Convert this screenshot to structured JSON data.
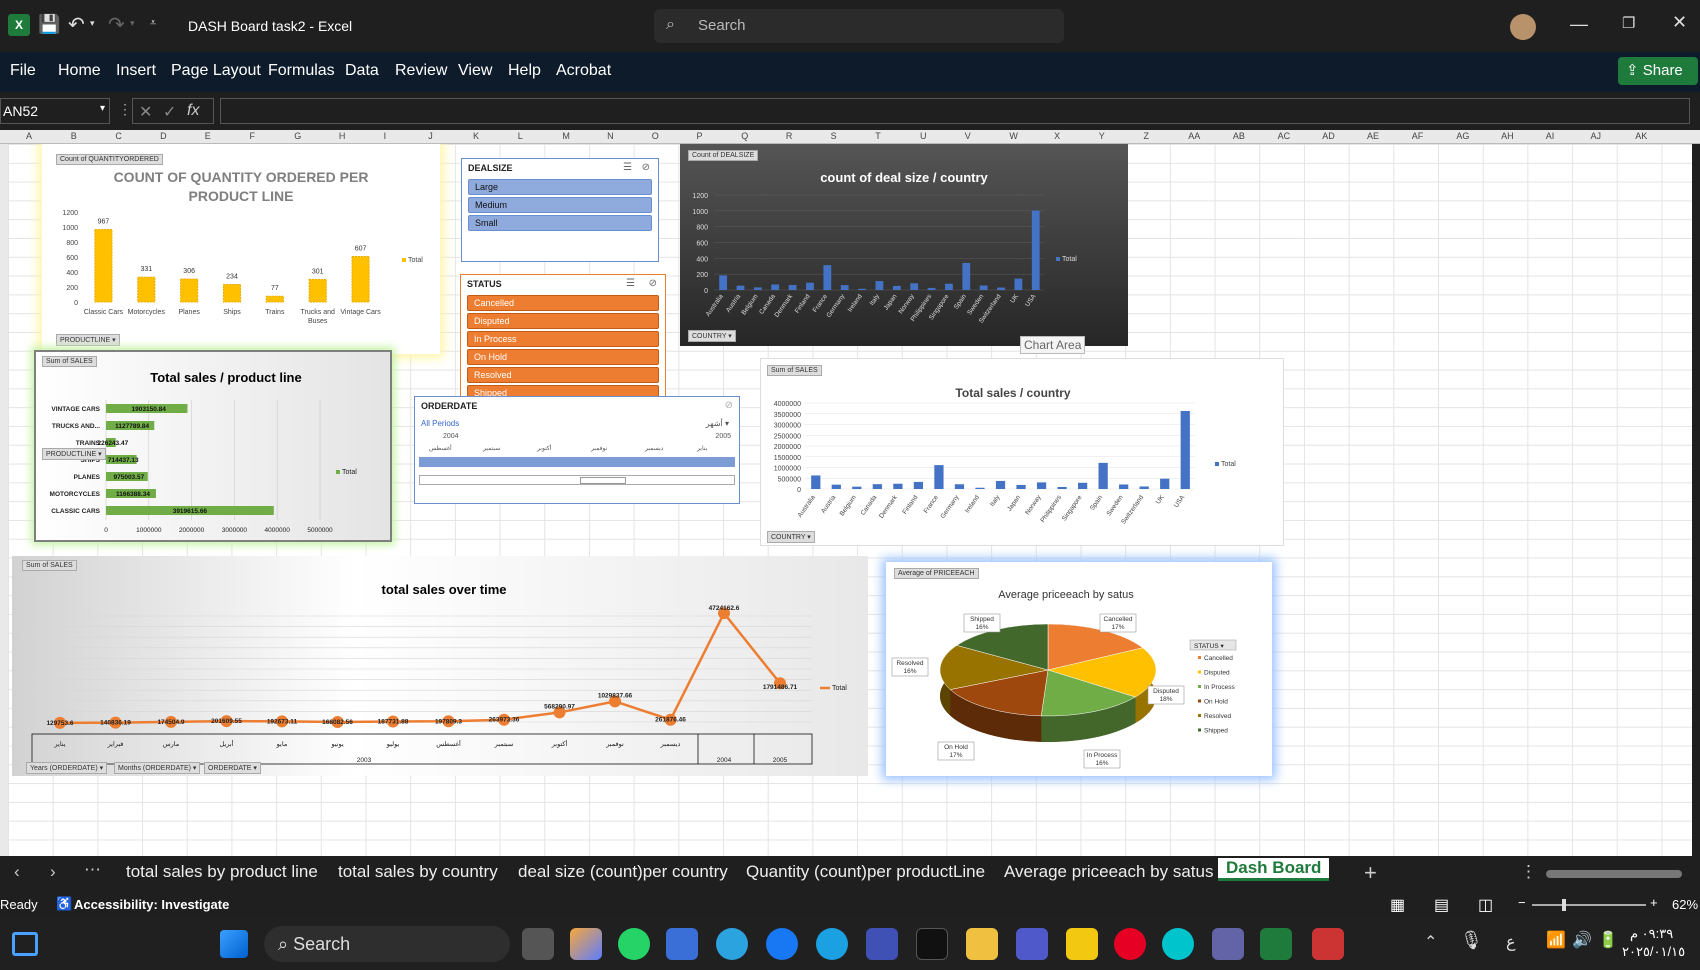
{
  "window": {
    "title": "DASH Board task2  -  Excel",
    "search_placeholder": "Search",
    "share": "Share"
  },
  "menu": [
    "File",
    "Home",
    "Insert",
    "Page Layout",
    "Formulas",
    "Data",
    "Review",
    "View",
    "Help",
    "Acrobat"
  ],
  "formula_bar": {
    "name_box": "AN52",
    "fx": "fx"
  },
  "columns": [
    "A",
    "B",
    "C",
    "D",
    "E",
    "F",
    "G",
    "H",
    "I",
    "J",
    "K",
    "L",
    "M",
    "N",
    "O",
    "P",
    "Q",
    "R",
    "S",
    "T",
    "U",
    "V",
    "W",
    "X",
    "Y",
    "Z",
    "AA",
    "AB",
    "AC",
    "AD",
    "AE",
    "AF",
    "AG",
    "AH",
    "AI",
    "AJ",
    "AK"
  ],
  "chart1": {
    "tag": "Count of QUANTITYORDERED",
    "title_line1": "COUNT OF QUANTITY ORDERED PER",
    "title_line2": "PRODUCT LINE",
    "legend": "Total",
    "filter": "PRODUCTLINE"
  },
  "chart_data": [
    {
      "type": "bar",
      "title": "COUNT OF QUANTITY ORDERED PER PRODUCT LINE",
      "categories": [
        "Classic Cars",
        "Motorcycles",
        "Planes",
        "Ships",
        "Trains",
        "Trucks and Buses",
        "Vintage Cars"
      ],
      "values": [
        967,
        331,
        306,
        234,
        77,
        301,
        607
      ],
      "ylim": [
        0,
        1200
      ],
      "yticks": [
        "1200",
        "1000",
        "800",
        "600",
        "400",
        "200",
        "0"
      ]
    },
    {
      "type": "bar",
      "title": "count of deal size / country",
      "categories": [
        "Australia",
        "Austria",
        "Belgium",
        "Canada",
        "Denmark",
        "Finland",
        "France",
        "Germany",
        "Ireland",
        "Italy",
        "Japan",
        "Norway",
        "Philippines",
        "Singapore",
        "Spain",
        "Sweden",
        "Switzerland",
        "UK",
        "USA"
      ],
      "values": [
        185,
        55,
        33,
        70,
        63,
        92,
        314,
        62,
        16,
        113,
        52,
        85,
        26,
        79,
        342,
        57,
        31,
        144,
        1004
      ],
      "ylim": [
        0,
        1200
      ],
      "yticks": [
        "1200",
        "1000",
        "800",
        "600",
        "400",
        "200",
        "0"
      ]
    },
    {
      "type": "bar",
      "title": "Total sales / product line",
      "categories": [
        "VINTAGE CARS",
        "TRUCKS AND...",
        "TRAINS",
        "SHIPS",
        "PLANES",
        "MOTORCYCLES",
        "CLASSIC CARS"
      ],
      "values": [
        1903150.84,
        1127789.84,
        226243.47,
        714437.13,
        975003.57,
        1166388.34,
        3919615.66
      ],
      "labels": [
        "1903150.84",
        "1127789.84",
        "226243.47",
        "714437.13",
        "975003.57",
        "1166388.34",
        "3919615.66"
      ],
      "xticks": [
        "0",
        "1000000",
        "2000000",
        "3000000",
        "4000000",
        "5000000"
      ],
      "xlim": [
        0,
        5000000
      ]
    },
    {
      "type": "bar",
      "title": "Total sales / country",
      "categories": [
        "Australia",
        "Austria",
        "Belgium",
        "Canada",
        "Denmark",
        "Finland",
        "France",
        "Germany",
        "Ireland",
        "Italy",
        "Japan",
        "Norway",
        "Philippines",
        "Singapore",
        "Spain",
        "Sweden",
        "Switzerland",
        "UK",
        "USA"
      ],
      "values": [
        630623,
        202062,
        108412,
        224079,
        245637,
        329581,
        1110916,
        220472,
        57756,
        374674,
        188168,
        307463,
        94016,
        288488,
        1215687,
        210014,
        117714,
        478880,
        3627983
      ],
      "ylim": [
        0,
        4000000
      ],
      "yticks": [
        "4000000",
        "3500000",
        "3000000",
        "2500000",
        "2000000",
        "1500000",
        "1000000",
        "500000",
        "0"
      ]
    },
    {
      "type": "line",
      "title": "total sales over time",
      "x": [
        "يناير",
        "فبراير",
        "مارس",
        "أبريل",
        "مايو",
        "يونيو",
        "يوليو",
        "أغسطس",
        "سبتمبر",
        "أكتوبر",
        "نوفمبر",
        "ديسمبر",
        "2004",
        "2005"
      ],
      "values": [
        129753.6,
        140836.19,
        174504.9,
        201609.55,
        192673.11,
        168082.56,
        187731.88,
        197809.3,
        263973.36,
        568290.97,
        1029837.66,
        261876.46,
        4724162.6,
        1791486.71
      ],
      "labels": [
        "129753.6",
        "140836.19",
        "174504.9",
        "201609.55",
        "192673.11",
        "168082.56",
        "187731.88",
        "197809.3",
        "263973.36",
        "568290.97",
        "1029837.66",
        "261876.46",
        "4724162.6",
        "1791486.71"
      ],
      "ylim": [
        0,
        5200000
      ]
    },
    {
      "type": "pie",
      "title": "Average priceeach by satus",
      "categories": [
        "Cancelled",
        "Disputed",
        "In Process",
        "On Hold",
        "Resolved",
        "Shipped"
      ],
      "values": [
        17,
        18,
        16,
        17,
        16,
        16
      ],
      "labels": [
        "Cancelled\n17%",
        "Disputed\n18%",
        "In Process\n16%",
        "On Hold\n17%",
        "Resolved\n16%",
        "Shipped\n16%"
      ],
      "colors": [
        "#ed7d31",
        "#ffc000",
        "#70ad47",
        "#9e480e",
        "#997300",
        "#43682b"
      ]
    }
  ],
  "chart2": {
    "tag": "Count of DEALSIZE",
    "legend": "Total",
    "filter": "COUNTRY",
    "chart_area_tip": "Chart Area"
  },
  "chart3": {
    "tag": "Sum of SALES",
    "legend": "Total",
    "filter": "PRODUCTLINE"
  },
  "chart4": {
    "tag": "Sum of SALES",
    "legend": "Total",
    "filter": "COUNTRY"
  },
  "chart5": {
    "tag": "Sum of SALES",
    "legend": "Total",
    "year_2003": "2003",
    "filters": [
      "Years (ORDERDATE)",
      "Months (ORDERDATE)",
      "ORDERDATE"
    ]
  },
  "chart6": {
    "tag": "Average of PRICEEACH",
    "legend_title": "STATUS"
  },
  "slicer_dealsize": {
    "title": "DEALSIZE",
    "items": [
      "Large",
      "Medium",
      "Small"
    ]
  },
  "slicer_status": {
    "title": "STATUS",
    "items": [
      "Cancelled",
      "Disputed",
      "In Process",
      "On Hold",
      "Resolved",
      "Shipped"
    ]
  },
  "timeline": {
    "title": "ORDERDATE",
    "periods": "All Periods",
    "unit": "أشهر",
    "year_start": "2004",
    "year_end": "2005",
    "months": [
      "أغسطس",
      "سبتمبر",
      "أكتوبر",
      "نوفمبر",
      "ديسمبر",
      "يناير"
    ]
  },
  "sheet_tabs": [
    "total sales by product line",
    "total sales by country",
    "deal size (count)per country",
    "Quantity (count)per productLine",
    "Average priceeach by satus",
    "Dash Board"
  ],
  "active_tab": "Dash Board",
  "status": {
    "ready": "Ready",
    "accessibility": "Accessibility: Investigate",
    "zoom": "62%"
  },
  "taskbar": {
    "search": "Search",
    "time": "٠٩:٣٩ م",
    "date": "٢٠٢٥/٠١/١٥",
    "lang": "ع"
  },
  "colors": {
    "slicer_blue": "#8faadc",
    "slicer_orange": "#ed7d31",
    "bar_gold": "#ffc000",
    "bar_blue": "#4472c4",
    "bar_green": "#70ad47",
    "line_orange": "#ed7d31",
    "share_green": "#1e7b3c"
  }
}
